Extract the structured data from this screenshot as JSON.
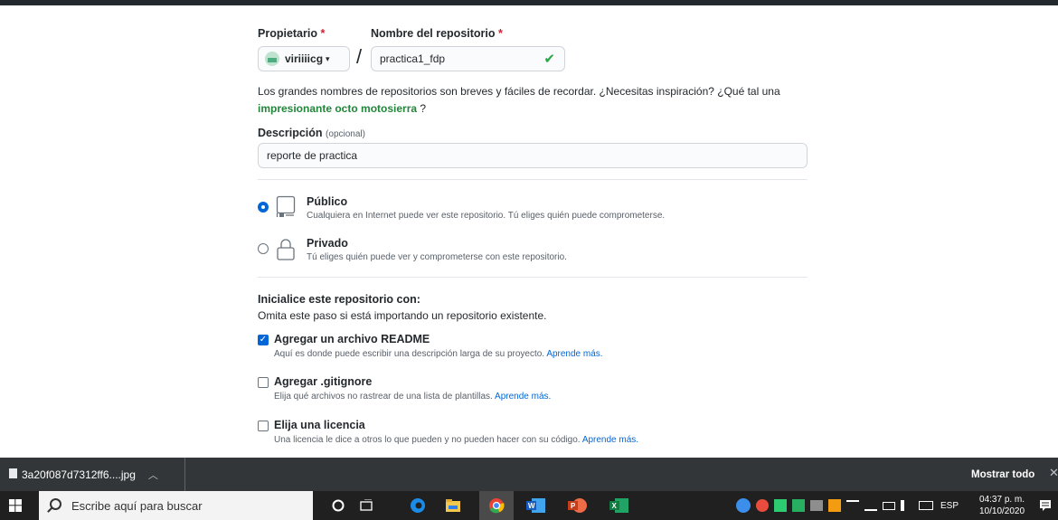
{
  "form": {
    "owner_label": "Propietario",
    "repo_label": "Nombre del repositorio",
    "required_mark": "*",
    "owner_value": "viriiiicg",
    "slash": "/",
    "repo_value": "practica1_fdp",
    "hint_text": "Los grandes nombres de repositorios son breves y fáciles de recordar. ¿Necesitas inspiración? ¿Qué tal una",
    "hint_suggestion": "impresionante octo motosierra",
    "hint_end": " ?",
    "description_label": "Descripción",
    "description_optional": "(opcional)",
    "description_value": "reporte de practica"
  },
  "visibility": {
    "public_title": "Público",
    "public_desc": "Cualquiera en Internet puede ver este repositorio. Tú eliges quién puede comprometerse.",
    "private_title": "Privado",
    "private_desc": "Tú eliges quién puede ver y comprometerse con este repositorio.",
    "selected": "public"
  },
  "init": {
    "title": "Inicialice este repositorio con:",
    "subtitle": "Omita este paso si está importando un repositorio existente.",
    "learn_more": "Aprende más.",
    "options": [
      {
        "label": "Agregar un archivo README",
        "desc": "Aquí es donde puede escribir una descripción larga de su proyecto.",
        "checked": true
      },
      {
        "label": "Agregar .gitignore",
        "desc": "Elija qué archivos no rastrear de una lista de plantillas.",
        "checked": false
      },
      {
        "label": "Elija una licencia",
        "desc": "Una licencia le dice a otros lo que pueden y no pueden hacer con su código.",
        "checked": false
      }
    ]
  },
  "download_bar": {
    "filename": "3a20f087d7312ff6....jpg",
    "show_all": "Mostrar todo",
    "close": "✕"
  },
  "taskbar": {
    "search_placeholder": "Escribe aquí para buscar",
    "language": "ESP",
    "time": "04:37 p. m.",
    "date": "10/10/2020"
  },
  "colors": {
    "accent": "#0366d6",
    "success": "#28a745",
    "suggestion": "#22863a",
    "required": "#cb2431"
  }
}
